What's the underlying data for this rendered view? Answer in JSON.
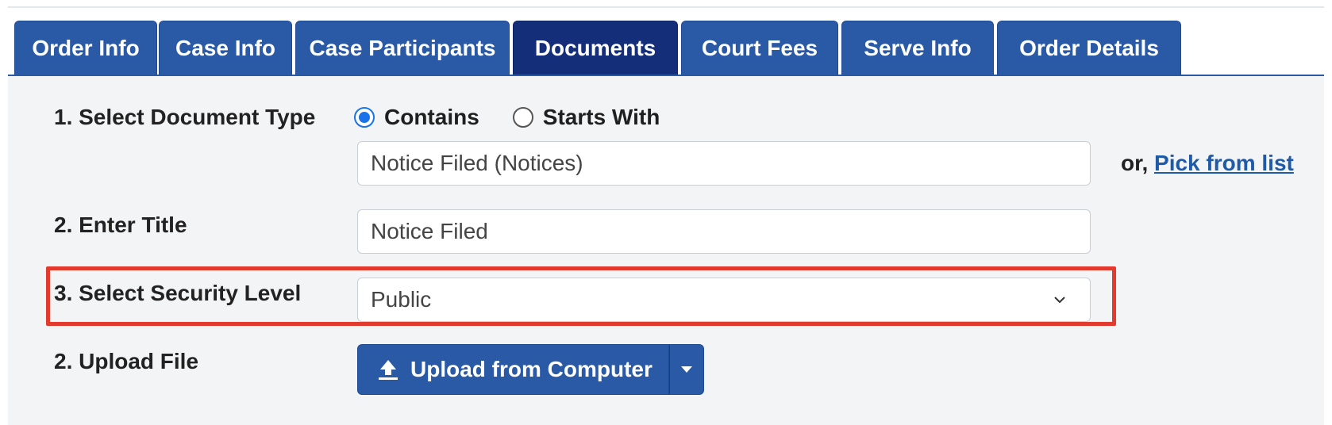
{
  "tabs": [
    {
      "label": "Order Info",
      "active": false
    },
    {
      "label": "Case Info",
      "active": false
    },
    {
      "label": "Case Participants",
      "active": false
    },
    {
      "label": "Documents",
      "active": true
    },
    {
      "label": "Court Fees",
      "active": false
    },
    {
      "label": "Serve Info",
      "active": false
    },
    {
      "label": "Order Details",
      "active": false
    }
  ],
  "step1": {
    "label": "1. Select Document Type",
    "radio_contains": "Contains",
    "radio_starts_with": "Starts With",
    "selected_radio": "Contains",
    "document_type_value": "Notice Filed (Notices)",
    "or_text": "or,",
    "pick_link": "Pick from list"
  },
  "step2": {
    "label": "2. Enter Title",
    "title_value": "Notice Filed"
  },
  "step3": {
    "label": "3. Select Security Level",
    "security_value": "Public"
  },
  "step4": {
    "label": "2. Upload File",
    "upload_label": "Upload from Computer"
  },
  "icons": {
    "upload": "upload-icon",
    "dropdown": "chevron-down-icon",
    "caret": "caret-down-icon"
  },
  "colors": {
    "tab_bg": "#2a59a6",
    "tab_active_bg": "#142e7a",
    "highlight": "#e23b2e",
    "link": "#1f5aa8",
    "radio_checked": "#1a73e8"
  }
}
